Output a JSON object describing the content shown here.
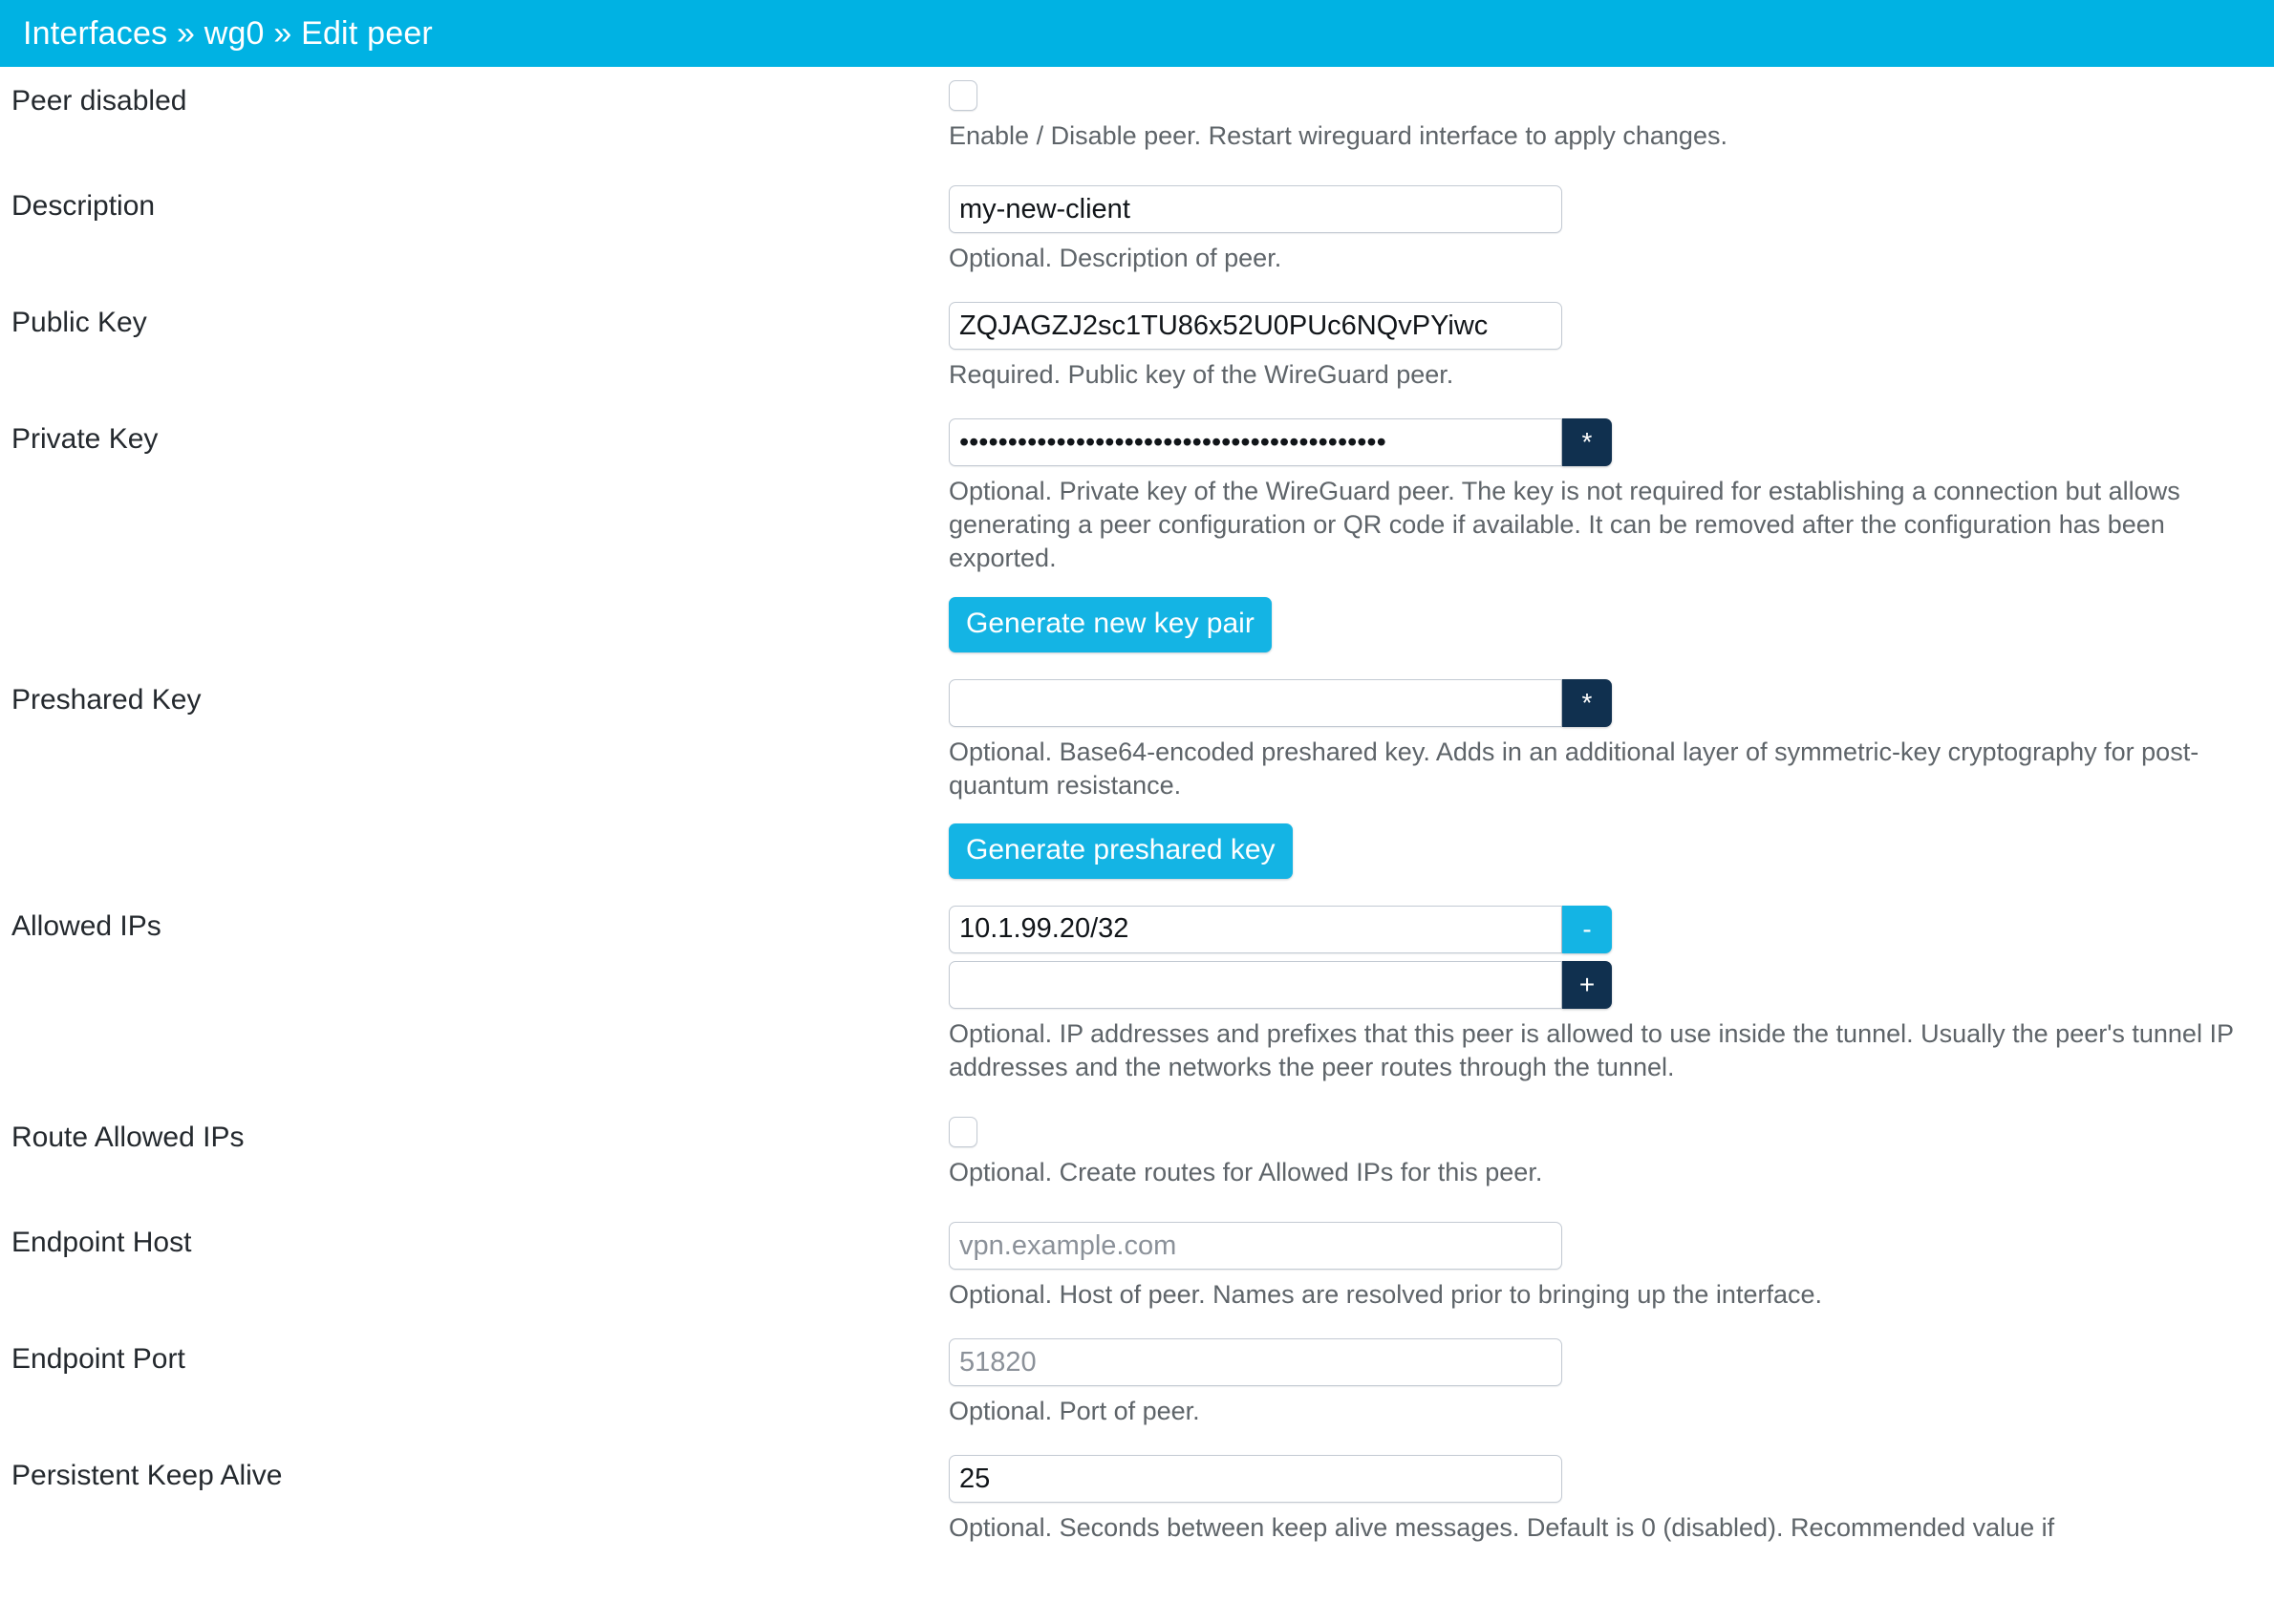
{
  "header": {
    "breadcrumb": "Interfaces » wg0 » Edit peer"
  },
  "form": {
    "rows": {
      "peer_disabled": {
        "label": "Peer disabled",
        "checked": false,
        "description": "Enable / Disable peer. Restart wireguard interface to apply changes."
      },
      "description": {
        "label": "Description",
        "value": "my-new-client",
        "description": "Optional. Description of peer."
      },
      "public_key": {
        "label": "Public Key",
        "value": "ZQJAGZJ2sc1TU86x52U0PUc6NQvPYiwc",
        "description": "Required. Public key of the WireGuard peer."
      },
      "private_key": {
        "label": "Private Key",
        "value": "••••••••••••••••••••••••••••••••••••••••••••",
        "toggle_icon": "asterisk-icon",
        "toggle_label": "*",
        "description": "Optional. Private key of the WireGuard peer. The key is not required for establishing a connection but allows generating a peer configuration or QR code if available. It can be removed after the configuration has been exported.",
        "button": "Generate new key pair"
      },
      "preshared_key": {
        "label": "Preshared Key",
        "value": "",
        "toggle_icon": "asterisk-icon",
        "toggle_label": "*",
        "description": "Optional. Base64-encoded preshared key. Adds in an additional layer of symmetric-key cryptography for post-quantum resistance.",
        "button": "Generate preshared key"
      },
      "allowed_ips": {
        "label": "Allowed IPs",
        "entries": [
          {
            "value": "10.1.99.20/32",
            "action_label": "-",
            "action_icon": "minus-icon",
            "action_style": "cyan"
          },
          {
            "value": "",
            "action_label": "+",
            "action_icon": "plus-icon",
            "action_style": "dark"
          }
        ],
        "description": "Optional. IP addresses and prefixes that this peer is allowed to use inside the tunnel. Usually the peer's tunnel IP addresses and the networks the peer routes through the tunnel."
      },
      "route_allowed_ips": {
        "label": "Route Allowed IPs",
        "checked": false,
        "description": "Optional. Create routes for Allowed IPs for this peer."
      },
      "endpoint_host": {
        "label": "Endpoint Host",
        "value": "",
        "placeholder": "vpn.example.com",
        "description": "Optional. Host of peer. Names are resolved prior to bringing up the interface."
      },
      "endpoint_port": {
        "label": "Endpoint Port",
        "value": "",
        "placeholder": "51820",
        "description": "Optional. Port of peer."
      },
      "persistent_keep_alive": {
        "label": "Persistent Keep Alive",
        "value": "25",
        "description": "Optional. Seconds between keep alive messages. Default is 0 (disabled). Recommended value if"
      }
    }
  },
  "colors": {
    "header_bg": "#00b2e3",
    "accent": "#14b4e4",
    "dark_addon": "#10304f",
    "label_text": "#24292e",
    "description_text": "#5e6469",
    "input_border": "#c3cad3",
    "placeholder_text": "#8b9199"
  }
}
